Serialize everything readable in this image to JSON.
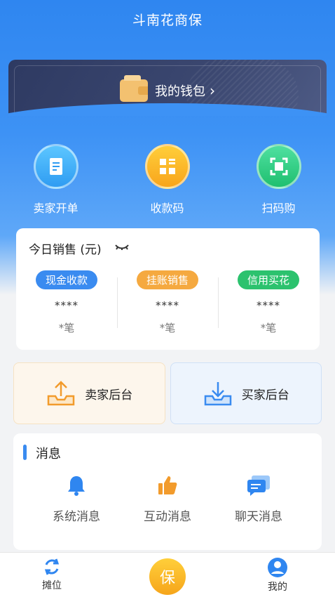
{
  "app": {
    "title": "斗南花商保"
  },
  "wallet": {
    "label": "我的钱包",
    "chevron": "›"
  },
  "quick_actions": [
    {
      "label": "卖家开单",
      "icon": "receipt-icon"
    },
    {
      "label": "收款码",
      "icon": "qr-grid-icon"
    },
    {
      "label": "扫码购",
      "icon": "scan-icon"
    }
  ],
  "sales": {
    "title": "今日销售 (元)",
    "columns": [
      {
        "tag": "现金收款",
        "amount": "****",
        "count": "*笔"
      },
      {
        "tag": "挂账销售",
        "amount": "****",
        "count": "*笔"
      },
      {
        "tag": "信用买花",
        "amount": "****",
        "count": "*笔"
      }
    ]
  },
  "backend": {
    "seller_label": "卖家后台",
    "buyer_label": "买家后台"
  },
  "messages": {
    "title": "消息",
    "items": [
      {
        "label": "系统消息",
        "icon": "bell-icon"
      },
      {
        "label": "互动消息",
        "icon": "thumbs-up-icon"
      },
      {
        "label": "聊天消息",
        "icon": "chat-icon"
      }
    ]
  },
  "tabbar": {
    "left": "摊位",
    "center": "保",
    "right": "我的"
  },
  "colors": {
    "primary": "#2f86f0",
    "orange": "#f5a940",
    "green": "#2cc26e"
  }
}
